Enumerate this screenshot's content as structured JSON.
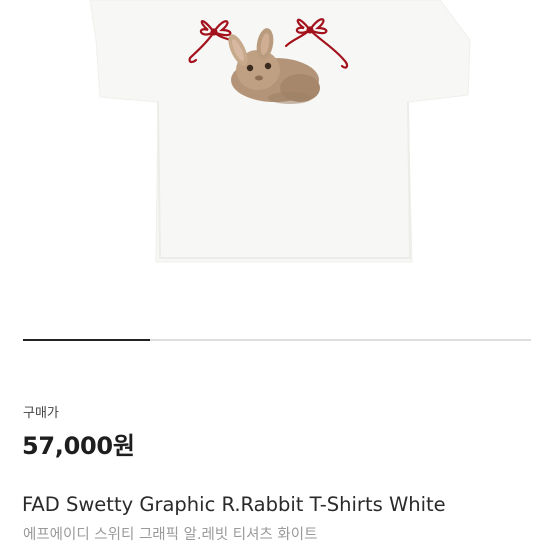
{
  "product": {
    "image_alt": "white t-shirt with rabbit and red ribbon bows graphic",
    "image_index_fraction": 0.25
  },
  "purchase": {
    "label": "구매가",
    "price": "57,000원"
  },
  "title": {
    "english": "FAD Swetty Graphic R.Rabbit T-Shirts White",
    "korean": "에프에이디 스위티 그래픽 알.레빗 티셔츠 화이트"
  },
  "colors": {
    "indicator_active": "#222222",
    "indicator_track": "#dedede",
    "ribbon": "#a3121c"
  }
}
